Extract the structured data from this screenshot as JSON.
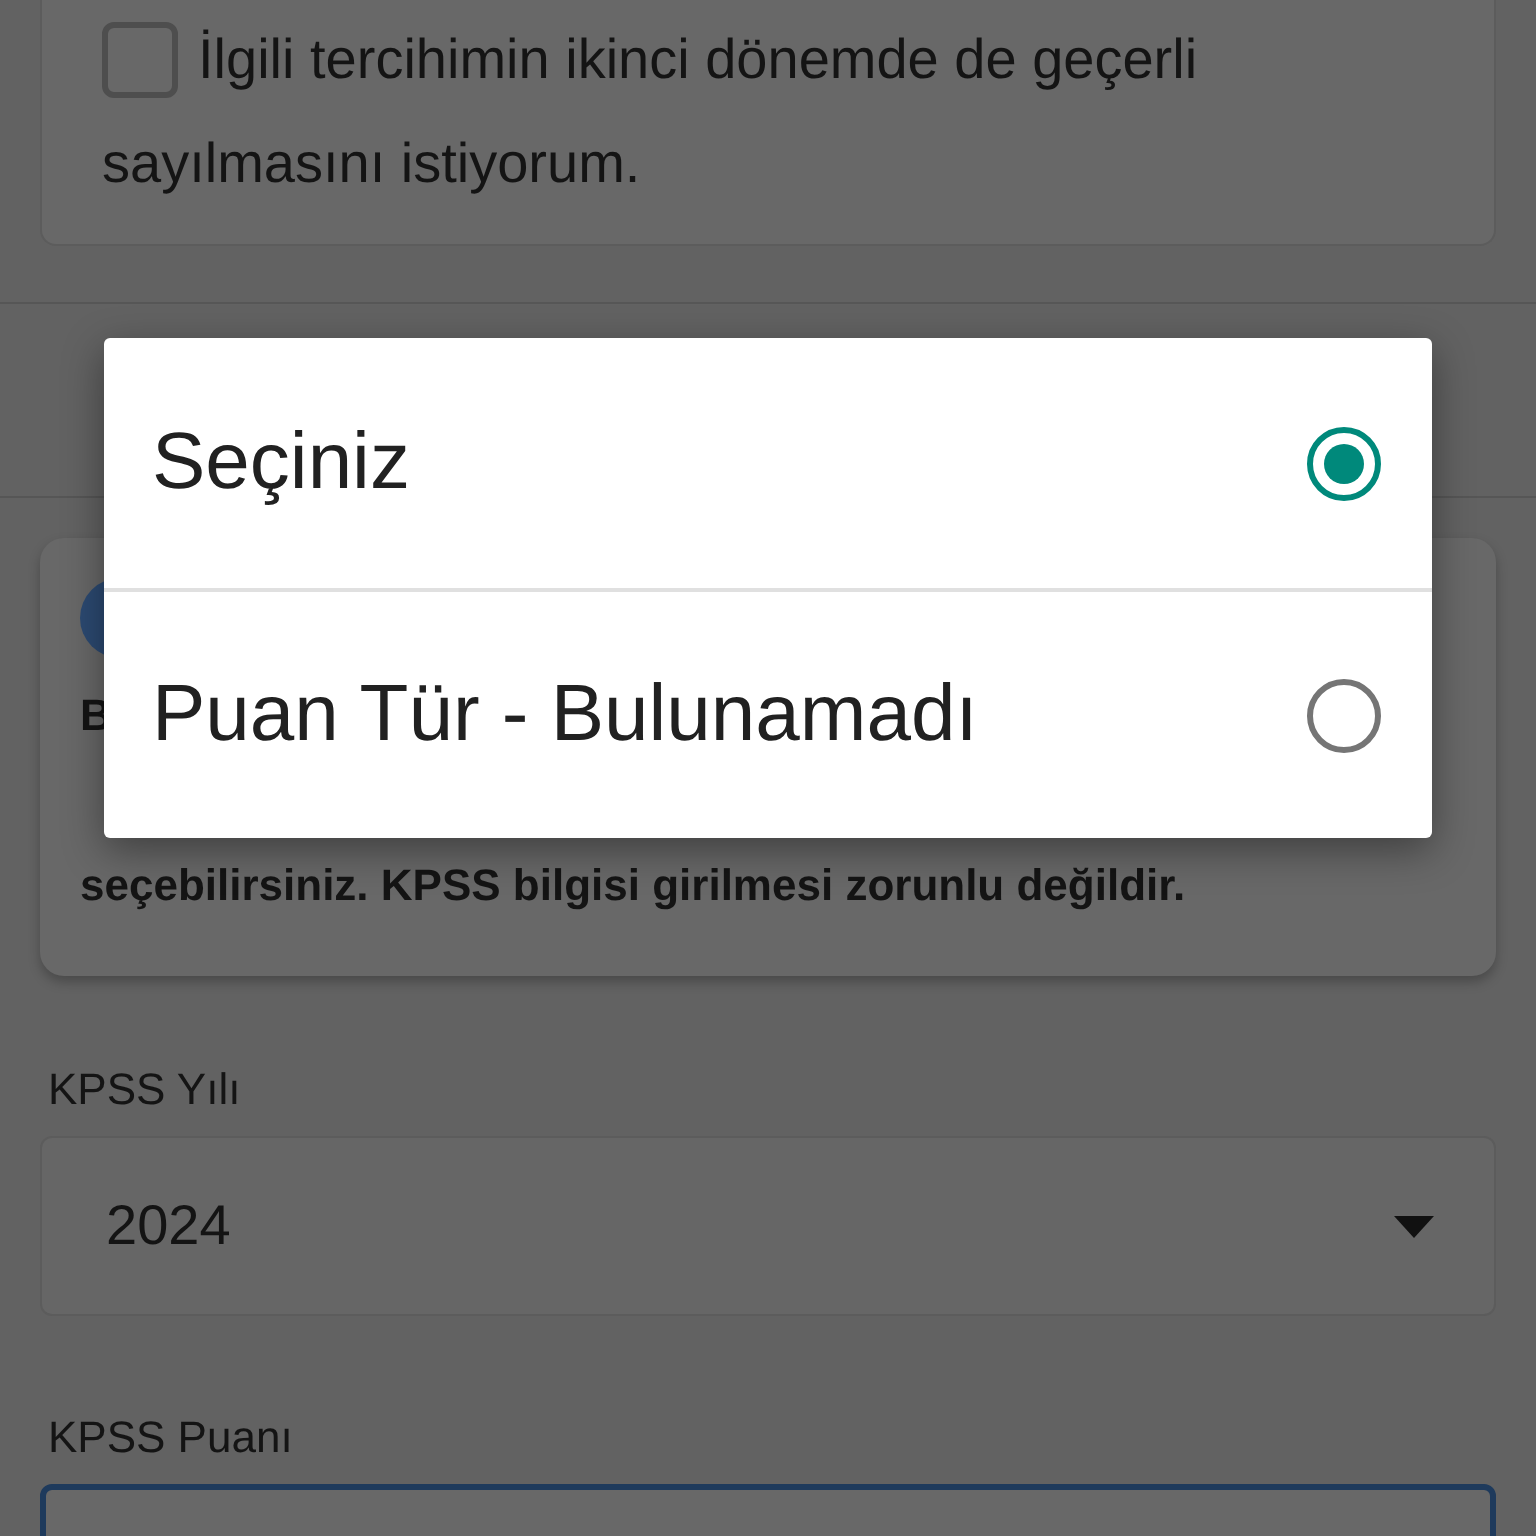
{
  "consent": {
    "label_lines": [
      "İlgili tercihimin ikinci dönemde de geçerli",
      "sayılmasını istiyorum."
    ],
    "checked": false
  },
  "info_card": {
    "lines": [
      "B",
      "seçebilirsiniz. KPSS bilgisi girilmesi zorunlu değildir."
    ]
  },
  "fields": [
    {
      "label": "KPSS Yılı",
      "kind": "select",
      "value": "2024"
    },
    {
      "label": "KPSS Puanı",
      "kind": "input"
    }
  ],
  "dialog": {
    "options": [
      {
        "label": "Seçiniz",
        "selected": true
      },
      {
        "label": "Puan Tür - Bulunamadı",
        "selected": false
      }
    ]
  }
}
